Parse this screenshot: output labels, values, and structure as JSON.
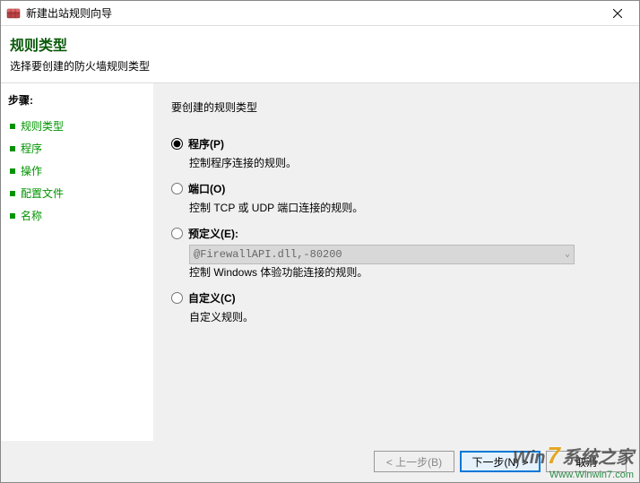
{
  "window": {
    "title": "新建出站规则向导"
  },
  "header": {
    "title": "规则类型",
    "subtitle": "选择要创建的防火墙规则类型"
  },
  "sidebar": {
    "steps_label": "步骤:",
    "items": [
      {
        "label": "规则类型"
      },
      {
        "label": "程序"
      },
      {
        "label": "操作"
      },
      {
        "label": "配置文件"
      },
      {
        "label": "名称"
      }
    ]
  },
  "main": {
    "question": "要创建的规则类型",
    "options": {
      "program": {
        "label": "程序(P)",
        "desc": "控制程序连接的规则。"
      },
      "port": {
        "label": "端口(O)",
        "desc": "控制 TCP 或 UDP 端口连接的规则。"
      },
      "predefined": {
        "label": "预定义(E):",
        "select_text": "@FirewallAPI.dll,-80200",
        "desc": "控制 Windows 体验功能连接的规则。"
      },
      "custom": {
        "label": "自定义(C)",
        "desc": "自定义规则。"
      }
    }
  },
  "footer": {
    "back": "< 上一步(B)",
    "next": "下一步(N) >",
    "cancel": "取消"
  },
  "watermark": {
    "prefix": "Win",
    "seven": "7",
    "suffix": "系统之家",
    "url": "Www.Winwin7.com"
  }
}
